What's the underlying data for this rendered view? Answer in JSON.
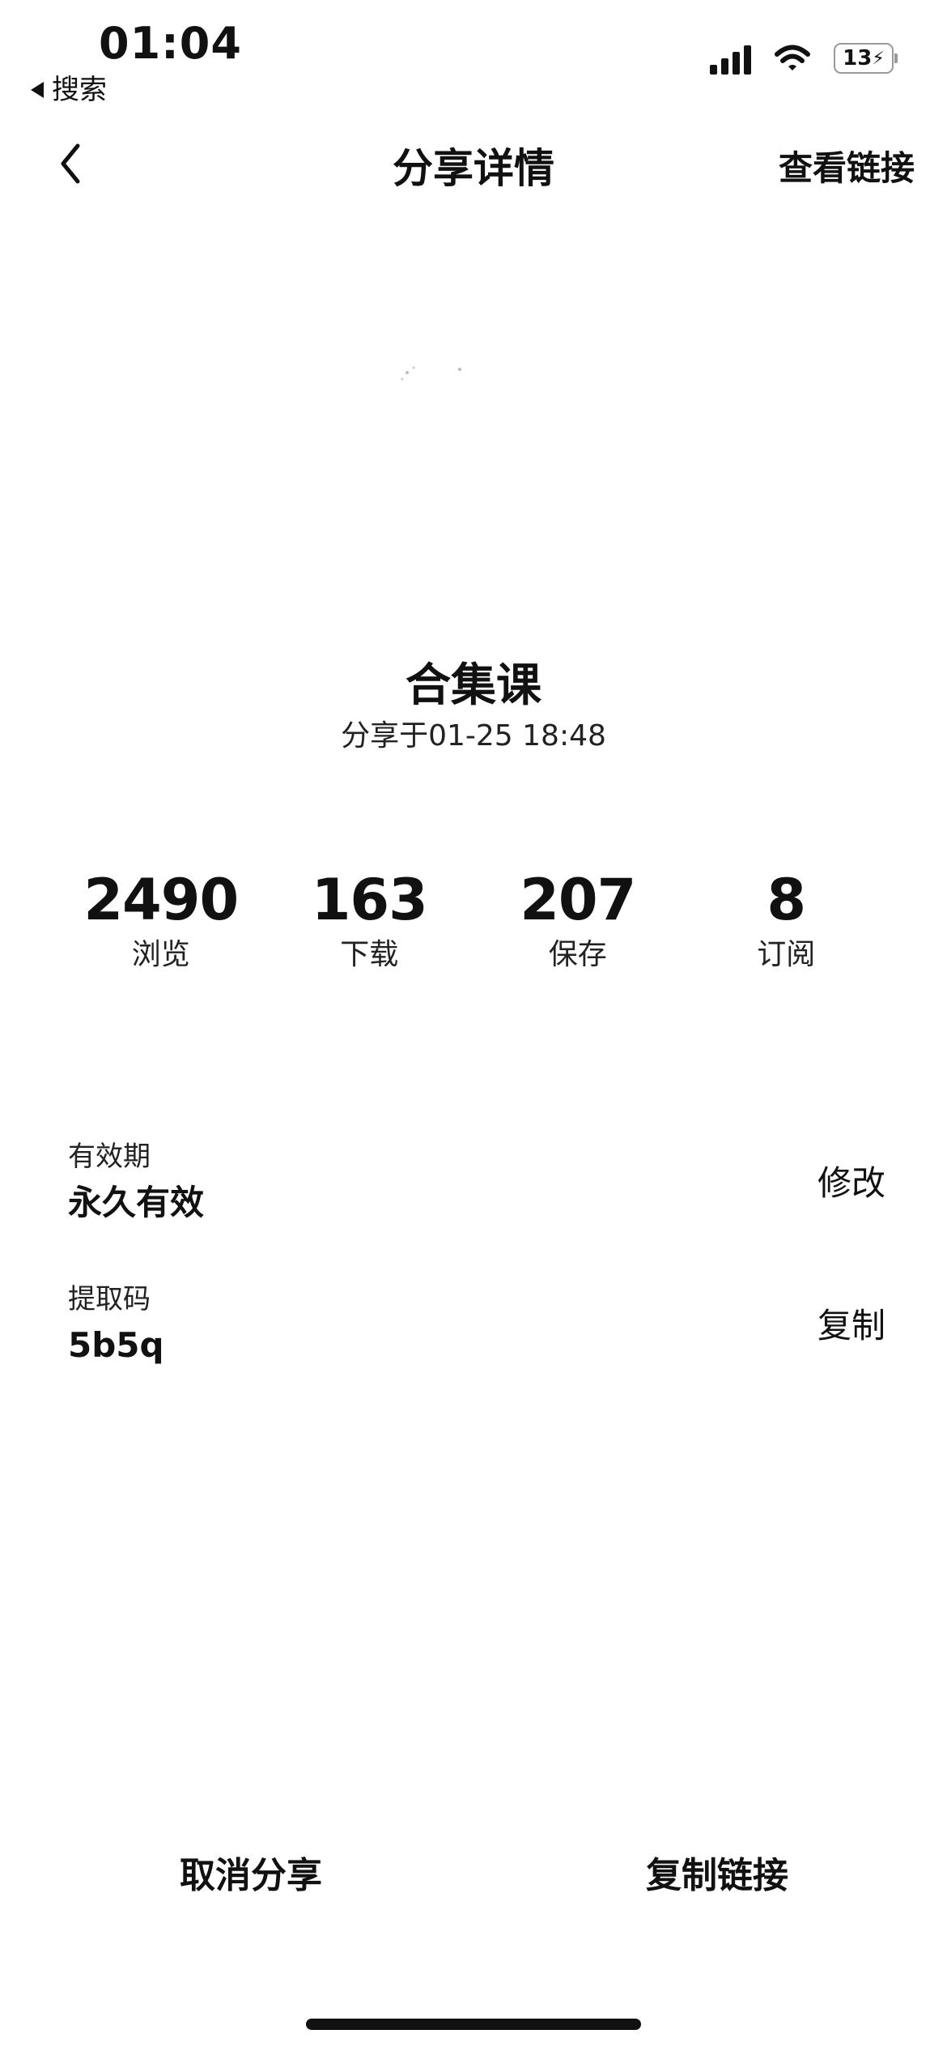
{
  "status_bar": {
    "time": "01:04",
    "back_app_label": "搜索",
    "battery": "13"
  },
  "nav": {
    "title": "分享详情",
    "right_link": "查看链接"
  },
  "file": {
    "name": "合集课",
    "shared_at": "分享于01-25 18:48"
  },
  "stats": [
    {
      "value": "2490",
      "label": "浏览"
    },
    {
      "value": "163",
      "label": "下载"
    },
    {
      "value": "207",
      "label": "保存"
    },
    {
      "value": "8",
      "label": "订阅"
    }
  ],
  "details": {
    "validity": {
      "label": "有效期",
      "value": "永久有效",
      "action": "修改"
    },
    "code": {
      "label": "提取码",
      "value": "5b5q",
      "action": "复制"
    }
  },
  "bottom": {
    "cancel_share": "取消分享",
    "copy_link": "复制链接"
  }
}
